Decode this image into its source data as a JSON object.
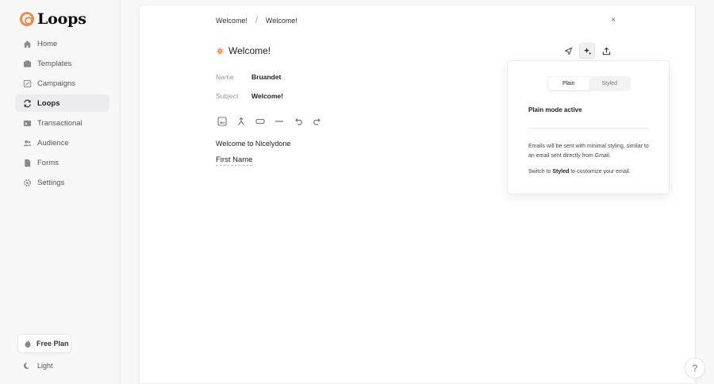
{
  "brand": {
    "name": "Loops",
    "accent": "#f08a4b"
  },
  "sidebar": {
    "items": [
      {
        "label": "Home",
        "icon": "home-icon"
      },
      {
        "label": "Templates",
        "icon": "templates-icon"
      },
      {
        "label": "Campaigns",
        "icon": "campaigns-icon"
      },
      {
        "label": "Loops",
        "icon": "loops-icon",
        "active": true
      },
      {
        "label": "Transactional",
        "icon": "transactional-icon"
      },
      {
        "label": "Audience",
        "icon": "audience-icon"
      },
      {
        "label": "Forms",
        "icon": "forms-icon"
      },
      {
        "label": "Settings",
        "icon": "settings-icon"
      }
    ],
    "plan_label": "Free Plan",
    "theme_label": "Light"
  },
  "breadcrumb": {
    "first": "Welcome!",
    "separator": "/",
    "second": "Welcome!"
  },
  "email": {
    "title": "Welcome!",
    "name_label": "Name",
    "name_value": "Bruandet",
    "subject_label": "Subject",
    "subject_value": "Welcome!",
    "body_line1": "Welcome to Nicelydone",
    "body_line2": "First Name"
  },
  "toolbar": {
    "icons": [
      "image-icon",
      "merge-tag-icon",
      "button-icon",
      "divider-icon",
      "undo-icon",
      "redo-icon"
    ]
  },
  "actions": {
    "icons": [
      "send-icon",
      "style-icon",
      "export-icon"
    ]
  },
  "popover": {
    "tab_plain": "Plain",
    "tab_styled": "Styled",
    "title": "Plain mode active",
    "description": "Emails will be sent with minimal styling, similar to an email sent directly from Gmail.",
    "switch_prefix": "Switch to",
    "switch_link": "Styled",
    "switch_suffix": "to customize your email."
  },
  "help": {
    "label": "?"
  },
  "close": {
    "label": "×"
  }
}
